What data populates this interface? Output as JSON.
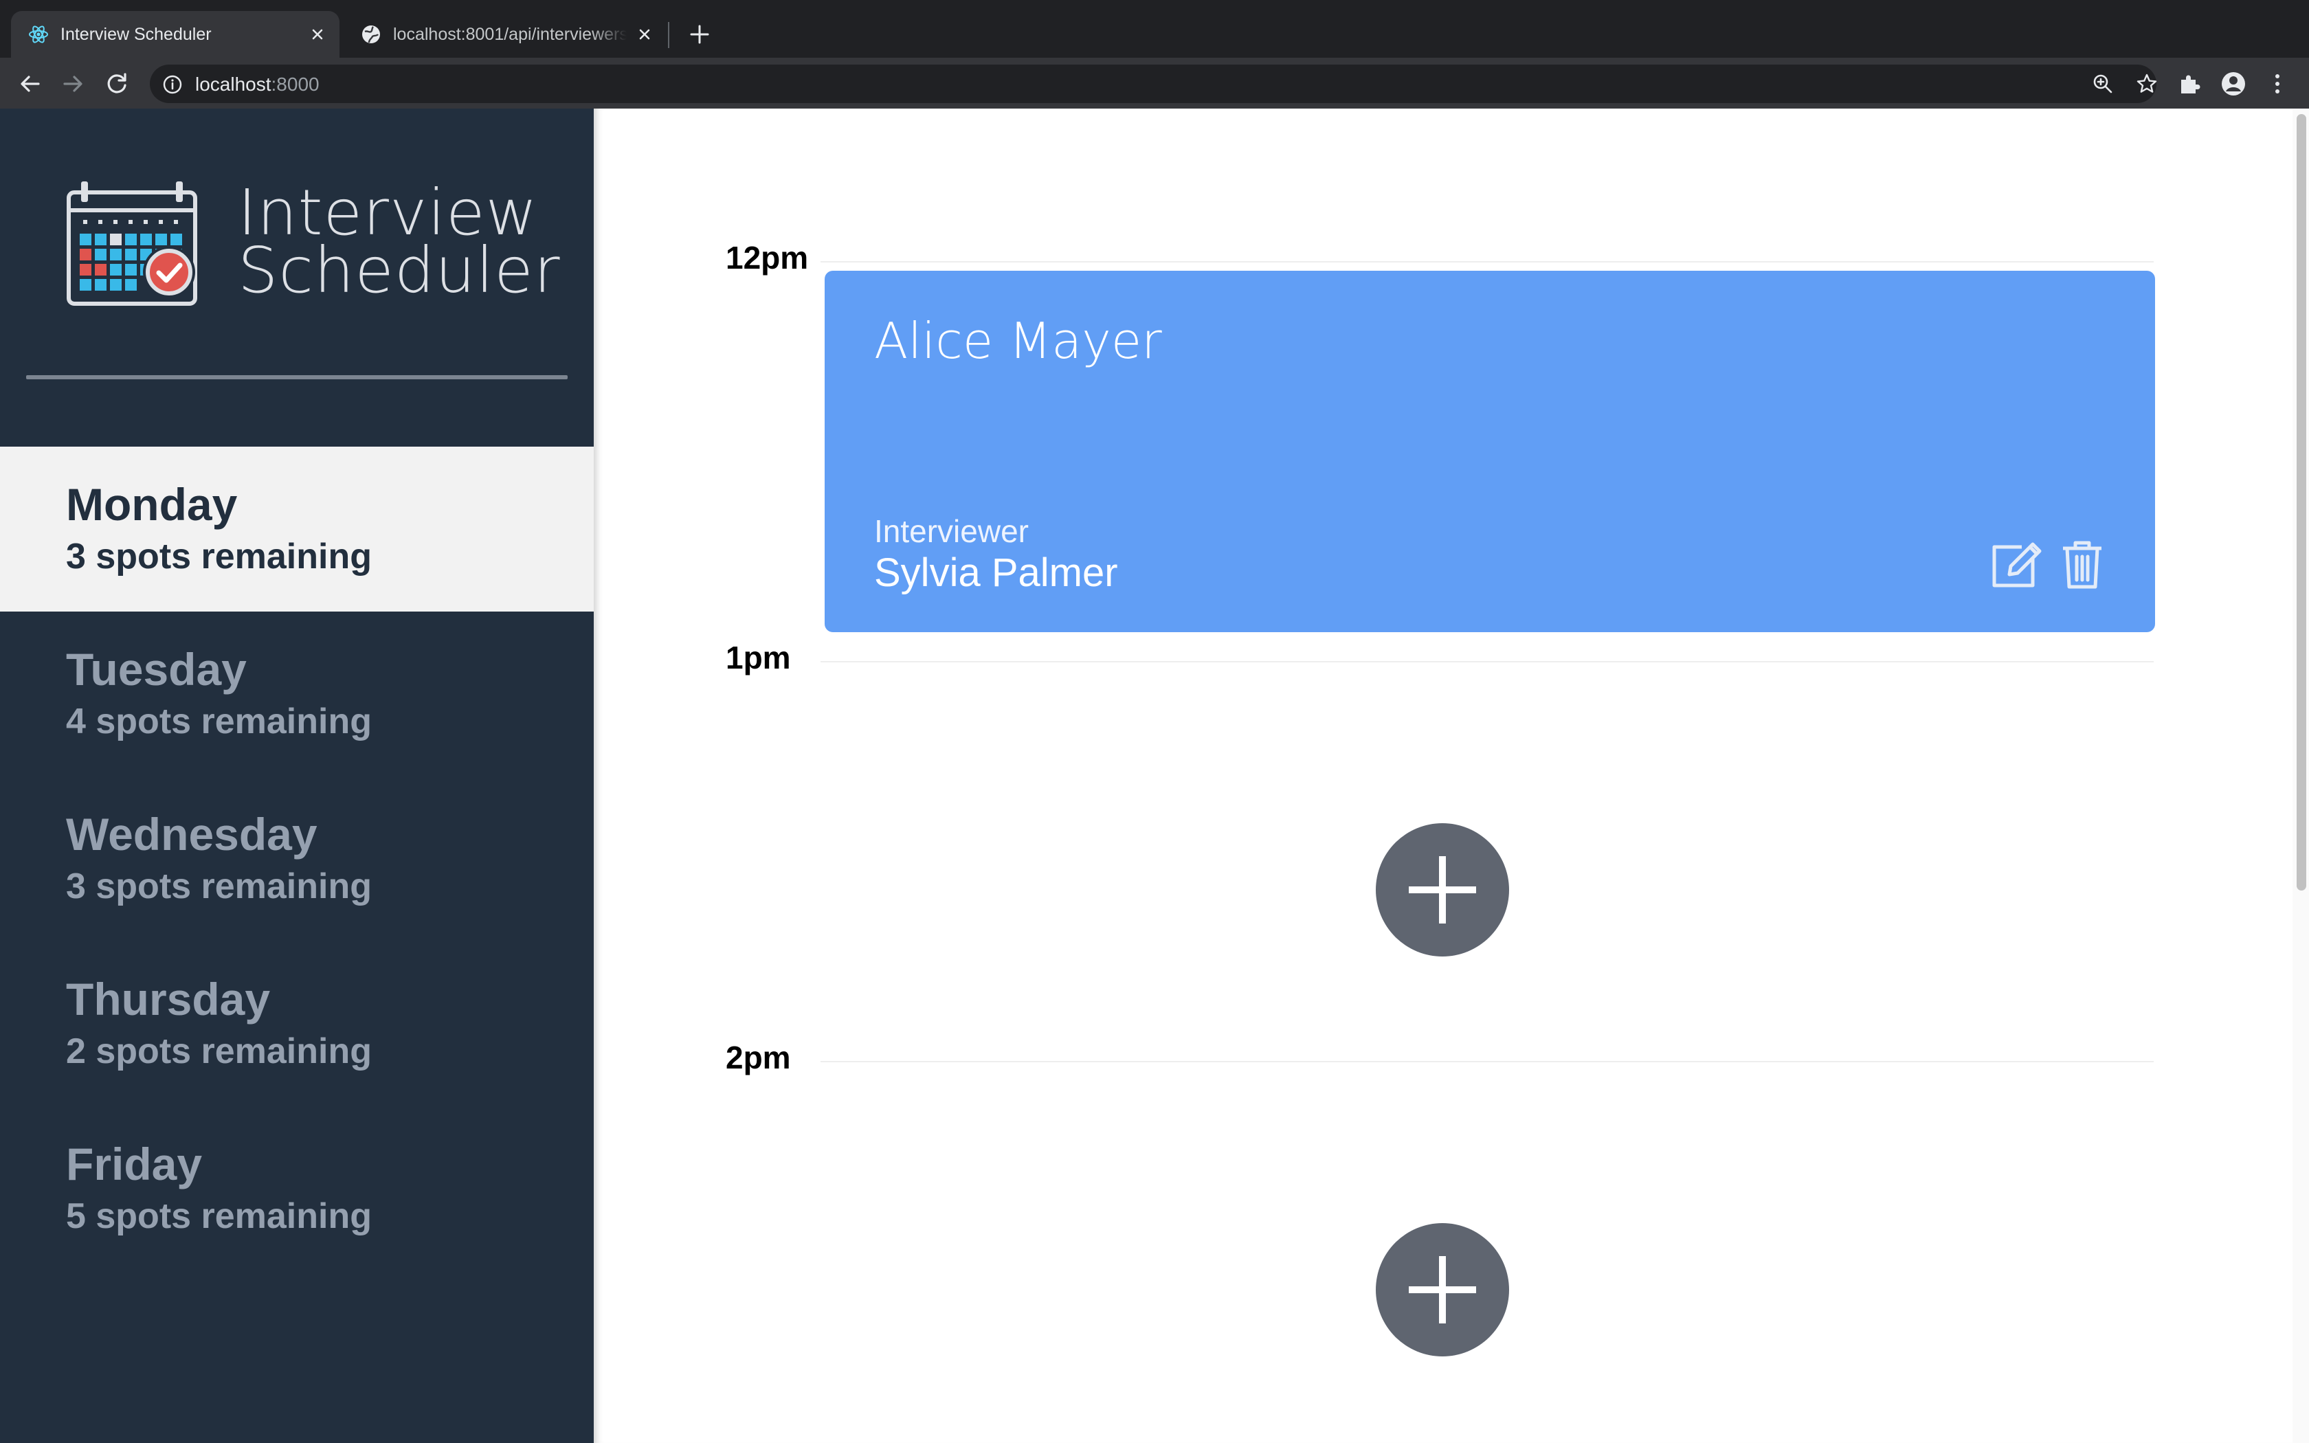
{
  "browser": {
    "tabs": [
      {
        "title": "Interview Scheduler",
        "favicon": "react-atom-icon",
        "active": true
      },
      {
        "title": "localhost:8001/api/interviewers",
        "favicon": "globe-icon",
        "active": false
      }
    ],
    "address": {
      "host": "localhost",
      "port": ":8000"
    }
  },
  "sidebar": {
    "brand_line1": "Interview",
    "brand_line2": "Scheduler",
    "days": [
      {
        "name": "Monday",
        "spots": "3 spots remaining",
        "selected": true
      },
      {
        "name": "Tuesday",
        "spots": "4 spots remaining",
        "selected": false
      },
      {
        "name": "Wednesday",
        "spots": "3 spots remaining",
        "selected": false
      },
      {
        "name": "Thursday",
        "spots": "2 spots remaining",
        "selected": false
      },
      {
        "name": "Friday",
        "spots": "5 spots remaining",
        "selected": false
      }
    ]
  },
  "schedule": {
    "slots": [
      {
        "time": "12pm",
        "booked": true,
        "student": "Alice Mayer",
        "interviewer_label": "Interviewer",
        "interviewer": "Sylvia Palmer"
      },
      {
        "time": "1pm",
        "booked": false
      },
      {
        "time": "2pm",
        "booked": false
      }
    ]
  },
  "colors": {
    "sidebar_bg": "#222f3e",
    "selected_day_bg": "#f2f2f2",
    "appointment_card": "#619ef5",
    "add_button": "#5f6570"
  }
}
